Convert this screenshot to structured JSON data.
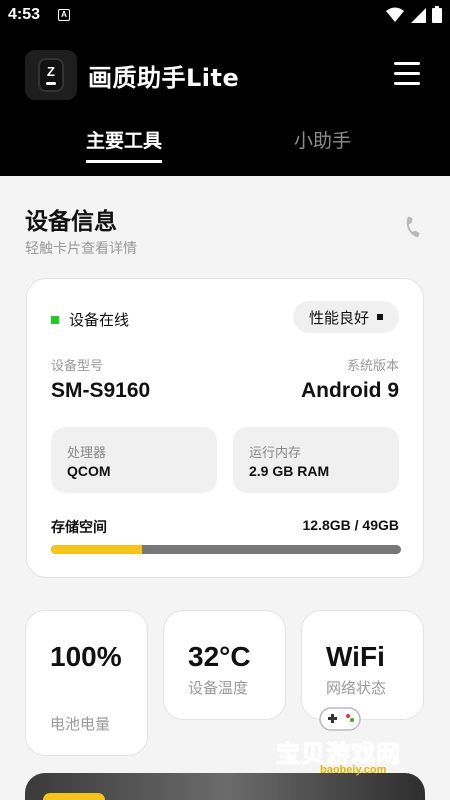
{
  "status_bar": {
    "time": "4:53",
    "notification_icon": "A"
  },
  "header": {
    "logo_letter": "Z",
    "title": "画质助手Lite",
    "tabs": [
      {
        "label": "主要工具",
        "active": true
      },
      {
        "label": "小助手",
        "active": false
      }
    ]
  },
  "device_info": {
    "title": "设备信息",
    "subtitle": "轻触卡片查看详情",
    "status": "设备在线",
    "performance": "性能良好",
    "model_label": "设备型号",
    "model_value": "SM-S9160",
    "version_label": "系统版本",
    "version_value": "Android 9",
    "cpu_label": "处理器",
    "cpu_value": "QCOM",
    "ram_label": "运行内存",
    "ram_value": "2.9 GB RAM",
    "storage_label": "存储空间",
    "storage_value": "12.8GB / 49GB",
    "storage_fraction": 0.26
  },
  "stats": [
    {
      "value": "100%",
      "label": "电池电量"
    },
    {
      "value": "32°C",
      "label": "设备温度"
    },
    {
      "value": "WiFi",
      "label": "网络状态"
    }
  ],
  "watermark": {
    "text": "宝贝游戏网",
    "url": "baobeiy.com"
  },
  "colors": {
    "accent": "#f6c21c",
    "online": "#22cc22",
    "header_bg": "#000000"
  }
}
